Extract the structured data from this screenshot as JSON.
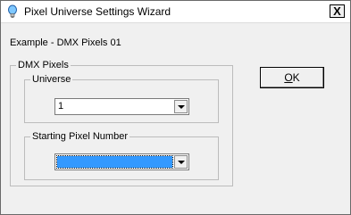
{
  "window": {
    "title": "Pixel Universe Settings Wizard",
    "close_glyph": "X"
  },
  "example_label": "Example - DMX Pixels 01",
  "dmx_group": {
    "legend": "DMX Pixels"
  },
  "universe": {
    "legend": "Universe",
    "value": "1"
  },
  "starting_pixel": {
    "legend": "Starting Pixel Number",
    "value": ""
  },
  "ok_button": {
    "label_underlined": "O",
    "label_rest": "K"
  }
}
